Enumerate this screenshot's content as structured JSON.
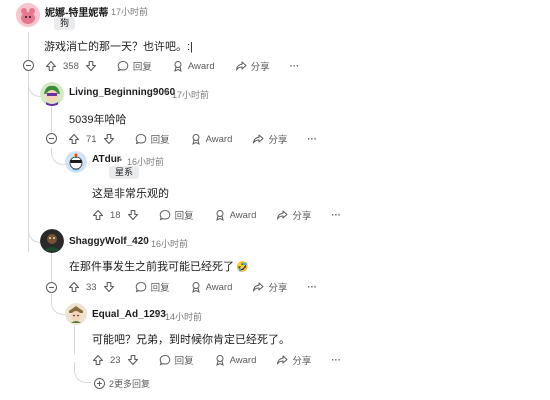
{
  "comments": [
    {
      "author": "妮娜-特里妮蒂",
      "time": "17小时前",
      "flair": "狗",
      "text": "游戏消亡的那一天？也许吧。:|",
      "votes": "358",
      "reply_label": "回复",
      "award_label": "Award",
      "share_label": "分享",
      "more_label": "···"
    },
    {
      "author": "Living_Beginning9060",
      "time": "17小时前",
      "text": "5039年哈哈",
      "votes": "71",
      "reply_label": "回复",
      "award_label": "Award",
      "share_label": "分享",
      "more_label": "···"
    },
    {
      "author": "ATdur",
      "time": "16小时前",
      "flair": "星系",
      "text": "这是非常乐观的",
      "votes": "18",
      "reply_label": "回复",
      "award_label": "Award",
      "share_label": "分享",
      "more_label": "···"
    },
    {
      "author": "ShaggyWolf_420",
      "time": "16小时前",
      "text": "在那件事发生之前我可能已经死了",
      "emoji": "🤣",
      "votes": "33",
      "reply_label": "回复",
      "award_label": "Award",
      "share_label": "分享",
      "more_label": "···"
    },
    {
      "author": "Equal_Ad_1293",
      "time": "14小时前",
      "text": "可能吧？兄弟，到时候你肯定已经死了。",
      "votes": "23",
      "reply_label": "回复",
      "award_label": "Award",
      "share_label": "分享",
      "more_label": "···"
    }
  ],
  "more_replies": "2更多回复",
  "separator": "•",
  "colors": {
    "text": "#1c1c1c",
    "meta": "#7c7c7c",
    "action": "#5c5c5c",
    "thread_line": "#d7dadc",
    "flair_bg": "#e9ebed"
  }
}
